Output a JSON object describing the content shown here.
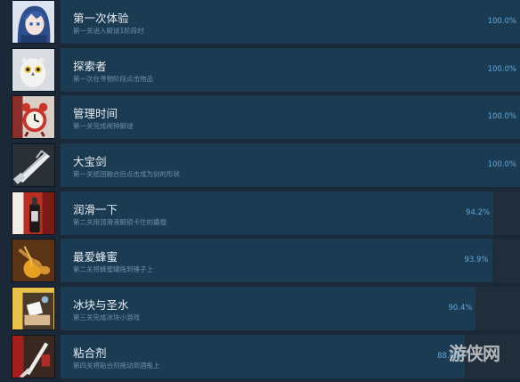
{
  "achievements": [
    {
      "title": "第一次体验",
      "desc": "第一关进入解谜1阶段时",
      "percent": "100.0%",
      "fill": 1.0,
      "icon": "girl-portrait-icon"
    },
    {
      "title": "探索者",
      "desc": "第一次在寻物阶段点击物品",
      "percent": "100.0%",
      "fill": 1.0,
      "icon": "owl-icon"
    },
    {
      "title": "管理时间",
      "desc": "第一关完成闹钟解谜",
      "percent": "100.0%",
      "fill": 1.0,
      "icon": "alarm-clock-icon"
    },
    {
      "title": "大宝剑",
      "desc": "第一关纸团融合后点击成为剑的形状",
      "percent": "100.0%",
      "fill": 1.0,
      "icon": "paper-sword-icon"
    },
    {
      "title": "润滑一下",
      "desc": "第二关用润滑液解锁卡住的撬棍",
      "percent": "94.2%",
      "fill": 0.942,
      "icon": "lubricant-bottle-icon"
    },
    {
      "title": "最爱蜂蜜",
      "desc": "第二关将蜂蜜罐拖到锤子上",
      "percent": "93.9%",
      "fill": 0.939,
      "icon": "honey-dipper-icon"
    },
    {
      "title": "冰块与圣水",
      "desc": "第三关完成冰块小游戏",
      "percent": "90.4%",
      "fill": 0.904,
      "icon": "ice-cube-icon"
    },
    {
      "title": "粘合剂",
      "desc": "第四关将粘合剂拖动到酒瓶上",
      "percent": "88.0%",
      "fill": 0.88,
      "icon": "glue-knife-icon"
    }
  ],
  "watermark": "游侠网",
  "colors": {
    "background": "#1b2838",
    "track": "#202e3c",
    "fill": "#1b3b52",
    "percent": "#62a8dc"
  }
}
